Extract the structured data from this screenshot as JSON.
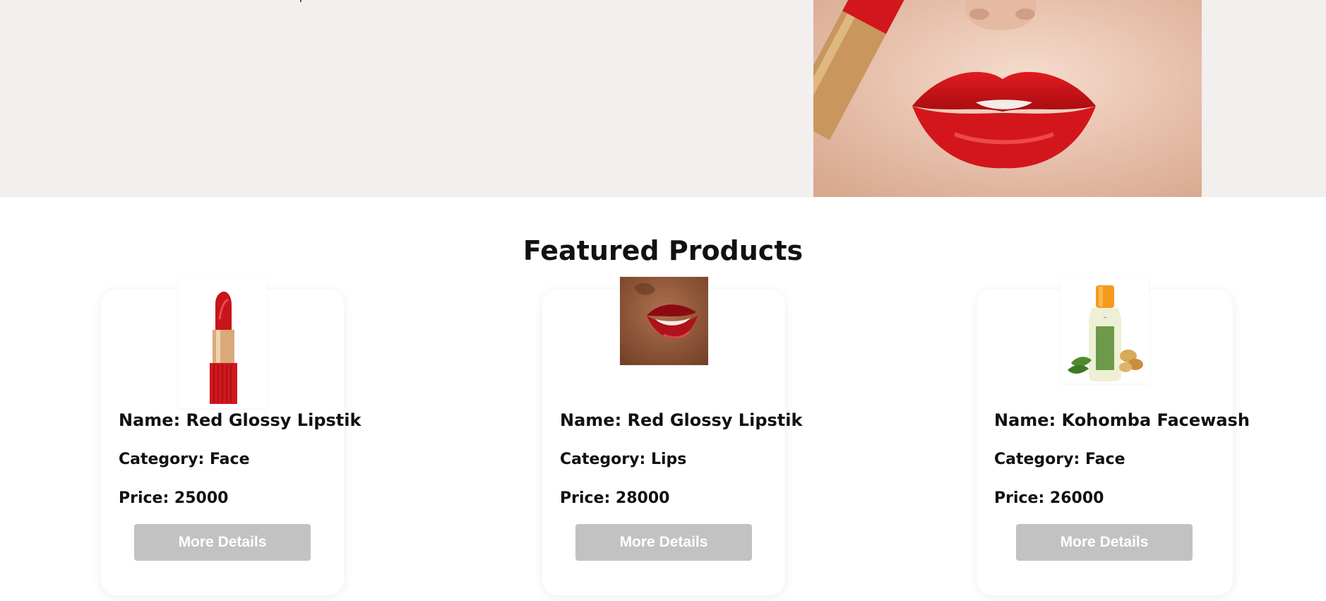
{
  "hero": {
    "image_icon": "lips-with-lipstick-photo"
  },
  "featured": {
    "title": "Featured Products",
    "products": [
      {
        "name": "Name: Red Glossy Lipstik",
        "category": "Category: Face",
        "price": "Price: 25000",
        "button_label": "More Details",
        "image_icon": "lipstick-tube-photo"
      },
      {
        "name": "Name: Red Glossy Lipstik",
        "category": "Category: Lips",
        "price": "Price: 28000",
        "button_label": "More Details",
        "image_icon": "red-lips-photo"
      },
      {
        "name": "Name: Kohomba Facewash",
        "category": "Category: Face",
        "price": "Price: 26000",
        "button_label": "More Details",
        "image_icon": "facewash-bottle-photo"
      }
    ]
  },
  "colors": {
    "hero_background": "#f3efee",
    "button_background": "#c2c2c2",
    "lipstick_red": "#d1161d"
  }
}
